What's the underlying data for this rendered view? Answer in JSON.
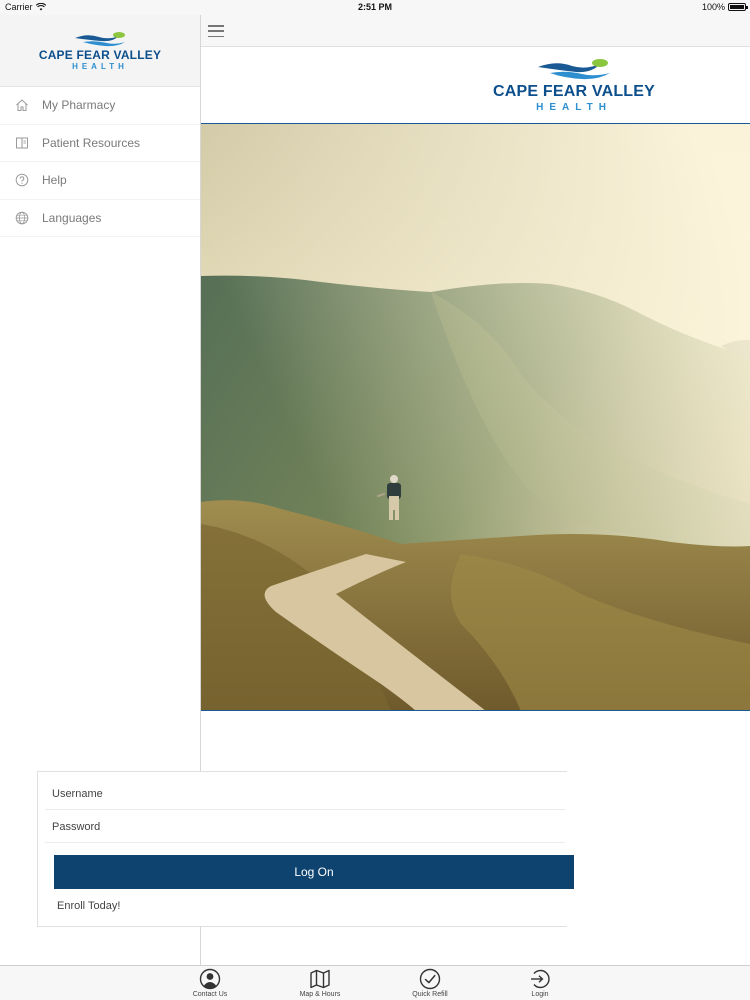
{
  "status_bar": {
    "carrier": "Carrier",
    "time": "2:51 PM",
    "battery": "100%"
  },
  "brand": {
    "name": "CAPE FEAR VALLEY",
    "subtitle": "HEALTH",
    "primary_color": "#0d4f8c",
    "accent_color": "#2d8fd0",
    "leaf_color": "#8cc63f"
  },
  "sidebar": {
    "items": [
      {
        "label": "My Pharmacy",
        "icon": "home-icon"
      },
      {
        "label": "Patient Resources",
        "icon": "book-icon"
      },
      {
        "label": "Help",
        "icon": "help-circle-icon"
      },
      {
        "label": "Languages",
        "icon": "globe-icon"
      }
    ]
  },
  "nav": {
    "menu_icon": "hamburger-icon"
  },
  "login": {
    "username_placeholder": "Username",
    "password_placeholder": "Password",
    "button_label": "Log On",
    "enroll_label": "Enroll Today!",
    "button_color": "#0e436f"
  },
  "tab_bar": {
    "tabs": [
      {
        "label": "Contact Us",
        "icon": "person-icon"
      },
      {
        "label": "Map & Hours",
        "icon": "map-icon"
      },
      {
        "label": "Quick Refill",
        "icon": "checkmark-circle-icon"
      },
      {
        "label": "Login",
        "icon": "login-arrow-icon"
      }
    ]
  }
}
